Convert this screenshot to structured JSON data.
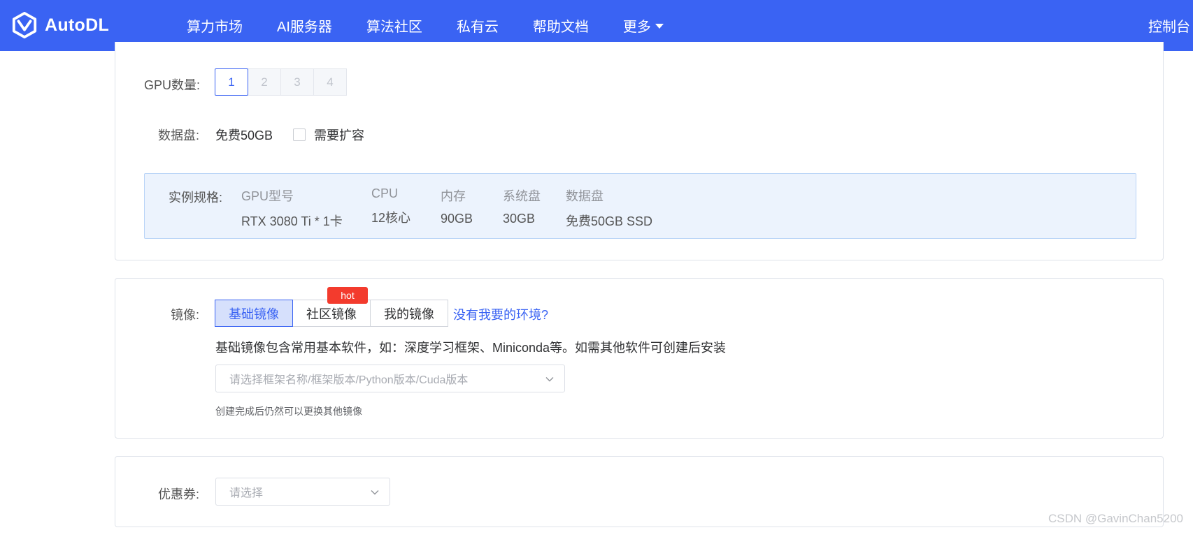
{
  "header": {
    "logo_text": "AutoDL",
    "nav": [
      "算力市场",
      "AI服务器",
      "算法社区",
      "私有云",
      "帮助文档",
      "更多"
    ],
    "console": "控制台",
    "brand_color": "#3a63f3"
  },
  "gpu_count": {
    "label": "GPU数量:",
    "options": [
      "1",
      "2",
      "3",
      "4"
    ],
    "selected": "1"
  },
  "data_disk": {
    "label": "数据盘:",
    "value": "免费50GB",
    "expand_label": "需要扩容",
    "expand_checked": false
  },
  "spec": {
    "label": "实例规格:",
    "columns": [
      {
        "header": "GPU型号",
        "value": "RTX 3080 Ti * 1卡"
      },
      {
        "header": "CPU",
        "value": "12核心"
      },
      {
        "header": "内存",
        "value": "90GB"
      },
      {
        "header": "系统盘",
        "value": "30GB"
      },
      {
        "header": "数据盘",
        "value": "免费50GB SSD"
      }
    ]
  },
  "image": {
    "label": "镜像:",
    "tabs": [
      "基础镜像",
      "社区镜像",
      "我的镜像"
    ],
    "active_tab": "基础镜像",
    "hot_badge": "hot",
    "no_env_link": "没有我要的环境?",
    "description": "基础镜像包含常用基本软件，如：深度学习框架、Miniconda等。如需其他软件可创建后安装",
    "select_placeholder": "请选择框架名称/框架版本/Python版本/Cuda版本",
    "note": "创建完成后仍然可以更换其他镜像"
  },
  "coupon": {
    "label": "优惠券:",
    "select_placeholder": "请选择"
  },
  "watermark": "CSDN @GavinChan5200"
}
